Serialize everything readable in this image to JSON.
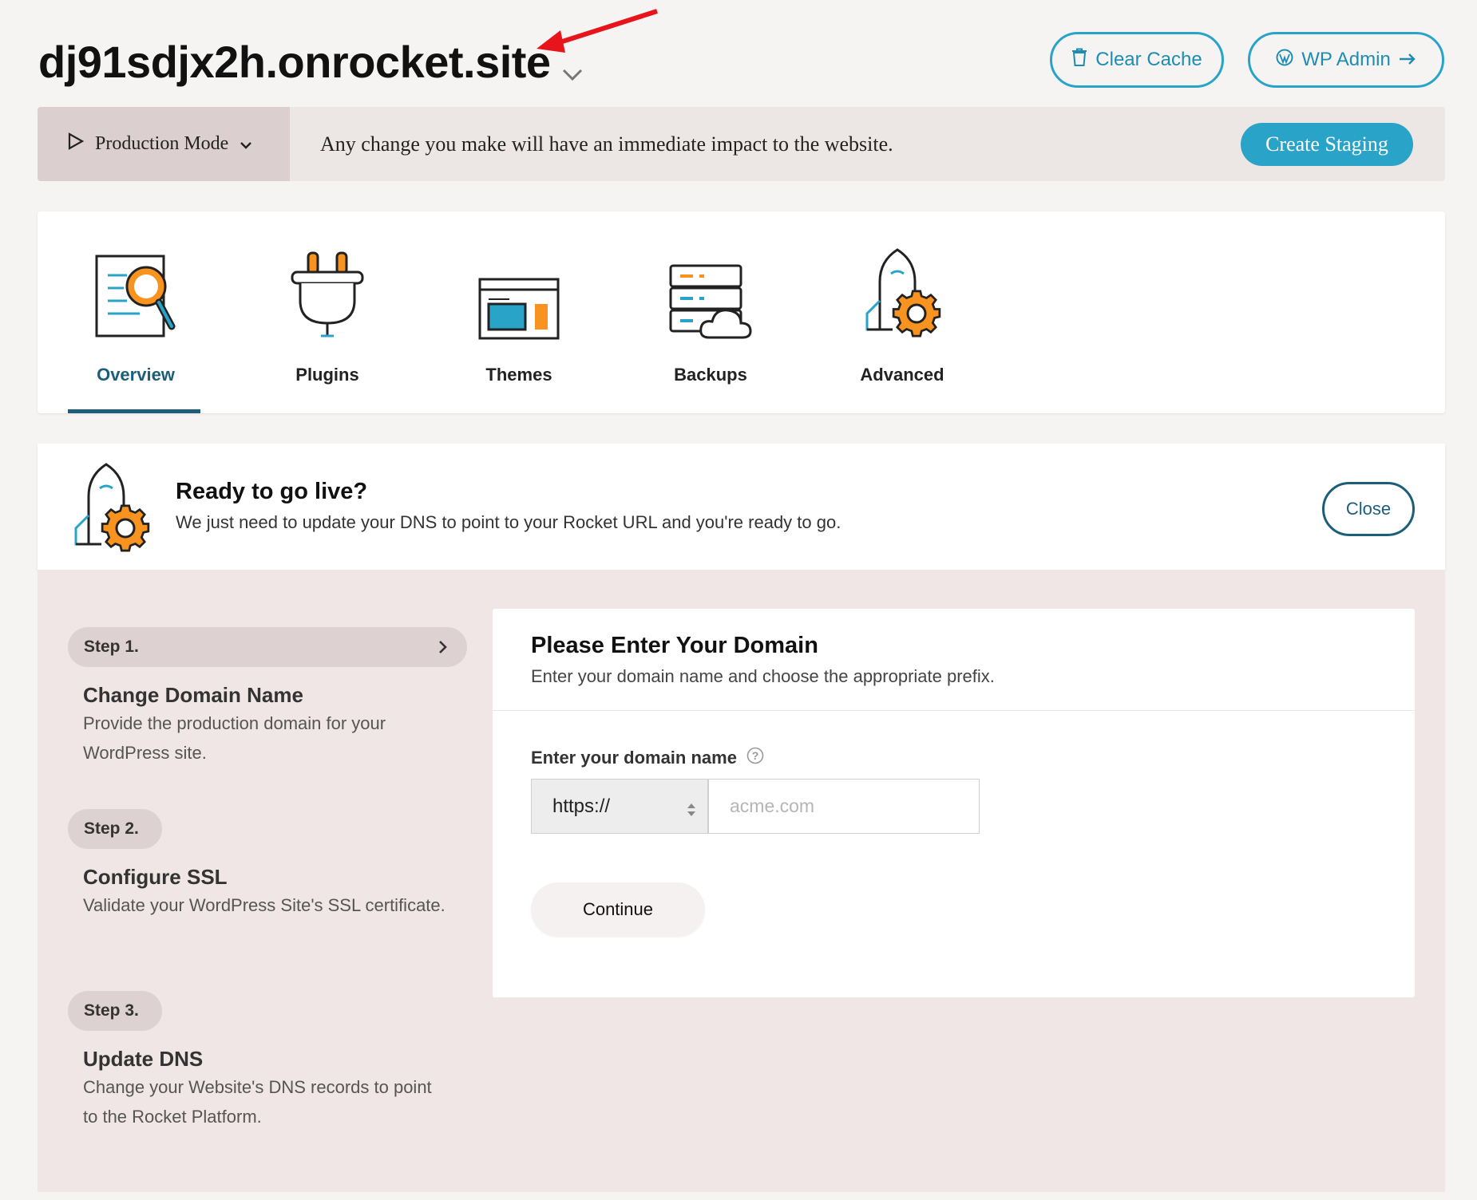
{
  "header": {
    "site_name": "dj91sdjx2h.onrocket.site",
    "clear_cache_label": "Clear Cache",
    "wp_admin_label": "WP Admin"
  },
  "mode_bar": {
    "mode_label": "Production Mode",
    "message": "Any change you make will have an immediate impact to the website.",
    "create_staging_label": "Create Staging"
  },
  "tabs": [
    {
      "label": "Overview",
      "icon": "overview-icon",
      "active": true
    },
    {
      "label": "Plugins",
      "icon": "plug-icon"
    },
    {
      "label": "Themes",
      "icon": "theme-icon"
    },
    {
      "label": "Backups",
      "icon": "backup-server-icon"
    },
    {
      "label": "Advanced",
      "icon": "rocket-gear-icon"
    }
  ],
  "ready": {
    "title": "Ready to go live?",
    "subtitle": "We just need to update your DNS to point to your Rocket URL and you're ready to go.",
    "close_label": "Close"
  },
  "steps": [
    {
      "step": "Step 1.",
      "title": "Change Domain Name",
      "desc": "Provide the production domain for your WordPress site."
    },
    {
      "step": "Step 2.",
      "title": "Configure SSL",
      "desc": "Validate your WordPress Site's SSL certificate."
    },
    {
      "step": "Step 3.",
      "title": "Update DNS",
      "desc": "Change your Website's DNS records to point to the Rocket Platform."
    }
  ],
  "domain_form": {
    "title": "Please Enter Your Domain",
    "subtitle": "Enter your domain name and choose the appropriate prefix.",
    "field_label": "Enter your domain name",
    "prefix_value": "https://",
    "domain_placeholder": "acme.com",
    "continue_label": "Continue"
  },
  "colors": {
    "accent": "#2aa3c9",
    "dark_teal": "#1c5e7a",
    "orange": "#f7931e",
    "annotation_red": "#e8141b"
  }
}
